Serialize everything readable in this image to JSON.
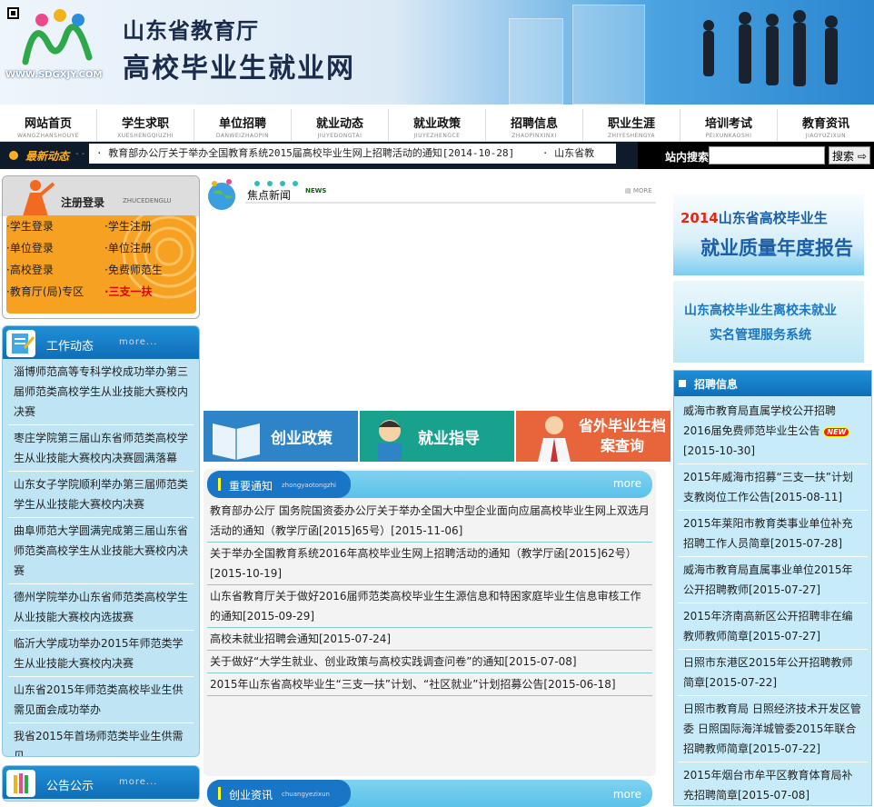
{
  "header": {
    "line1": "山东省教育厅",
    "line2": "高校毕业生就业网",
    "site": "WWW.SDGXJY.COM"
  },
  "nav": [
    {
      "zh": "网站首页",
      "py": "WANGZHANSHOUYE"
    },
    {
      "zh": "学生求职",
      "py": "XUESHENGQIUZHI"
    },
    {
      "zh": "单位招聘",
      "py": "DANWEIZHAOPIN"
    },
    {
      "zh": "就业动态",
      "py": "JIUYEDONGTAI"
    },
    {
      "zh": "就业政策",
      "py": "JIUYEZHENGCE"
    },
    {
      "zh": "招聘信息",
      "py": "ZHAOPINXINXI"
    },
    {
      "zh": "职业生涯",
      "py": "ZHIYESHENGYA"
    },
    {
      "zh": "培训考试",
      "py": "PEIXUNKAOSHI"
    },
    {
      "zh": "教育资讯",
      "py": "JIAOYUZIXUN"
    }
  ],
  "ticker": {
    "label": "最新动态",
    "items": [
      "· 教育部办公厅关于举办全国教育系统2015届高校毕业生网上招聘活动的通知[2014-10-28]",
      "· 山东省教"
    ]
  },
  "search": {
    "label": "站内搜索",
    "button": "搜索"
  },
  "login": {
    "title": "注册登录",
    "py": "ZHUCEDENGLU",
    "links": [
      "·学生登录",
      "·学生注册",
      "·单位登录",
      "·单位注册",
      "·高校登录",
      "·免费师范生",
      "·教育厅(局)专区",
      "·三支一扶"
    ]
  },
  "work": {
    "title": "工作动态",
    "more": "more...",
    "items": [
      "淄博师范高等专科学校成功举办第三届师范类高校学生从业技能大赛校内决赛",
      "枣庄学院第三届山东省师范类高校学生从业技能大赛校内决赛圆满落幕",
      "山东女子学院顺利举办第三届师范类学生从业技能大赛校内决赛",
      "曲阜师范大学圆满完成第三届山东省师范类高校学生从业技能大赛校内决赛",
      "德州学院举办山东省师范类高校学生从业技能大赛校内选拔赛",
      "临沂大学成功举办2015年师范类学生从业技能大赛校内决赛",
      "山东省2015年师范类高校毕业生供需见面会成功举办",
      "我省2015年首场师范类毕业生供需见"
    ]
  },
  "notice": {
    "title": "公告公示",
    "more": "more..."
  },
  "focus": {
    "title": "焦点新闻",
    "en": "NEWS",
    "more": "MORE"
  },
  "tiles": [
    {
      "label": "创业政策",
      "color": "#2f83c7"
    },
    {
      "label": "就业指导",
      "color": "#18a18c"
    },
    {
      "label": "省外毕业生档案查询",
      "color": "#e8643a"
    }
  ],
  "important": {
    "title": "重要通知",
    "py": "zhongyaotongzhi",
    "more": "more",
    "items": [
      "教育部办公厅 国务院国资委办公厅关于举办全国大中型企业面向应届高校毕业生网上双选月活动的通知（教学厅函[2015]65号）[2015-11-06]",
      "关于举办全国教育系统2016年高校毕业生网上招聘活动的通知（教学厅函[2015]62号）[2015-10-19]",
      "山东省教育厅关于做好2016届师范类高校毕业生生源信息和特困家庭毕业生信息审核工作的通知[2015-09-29]",
      "高校未就业招聘会通知[2015-07-24]",
      "关于做好“大学生就业、创业政策与高校实践调查问卷”的通知[2015-07-08]",
      "2015年山东省高校毕业生“三支一扶”计划、“社区就业”计划招募公告[2015-06-18]"
    ]
  },
  "chuangye": {
    "title": "创业资讯",
    "py": "chuangyezixun",
    "more": "more"
  },
  "right_banners": {
    "b1_year": "2014",
    "b1_rest": "山东省高校毕业生",
    "b1_line2": "就业质量年度报告",
    "b2_line1": "山东高校毕业生离校未就业",
    "b2_line2": "实名管理服务系统"
  },
  "recruit": {
    "title": "招聘信息",
    "new_badge": "NEW",
    "items": [
      {
        "text": "威海市教育局直属学校公开招聘2016届免费师范毕业生公告",
        "date": "[2015-10-30]"
      },
      {
        "text": "2015年威海市招募“三支一扶”计划支教岗位工作公告[2015-08-11]",
        "date": ""
      },
      {
        "text": "2015年莱阳市教育类事业单位补充招聘工作人员简章[2015-07-28]",
        "date": ""
      },
      {
        "text": "威海市教育局直属事业单位2015年公开招聘教师[2015-07-27]",
        "date": ""
      },
      {
        "text": "2015年济南高新区公开招聘非在编教师教师简章[2015-07-27]",
        "date": ""
      },
      {
        "text": "日照市东港区2015年公开招聘教师简章[2015-07-22]",
        "date": ""
      },
      {
        "text": "日照市教育局 日照经济技术开发区管委 日照国际海洋城管委2015年联合招聘教师简章[2015-07-22]",
        "date": ""
      },
      {
        "text": "2015年烟台市牟平区教育体育局补充招聘简章[2015-07-08]",
        "date": ""
      }
    ]
  }
}
